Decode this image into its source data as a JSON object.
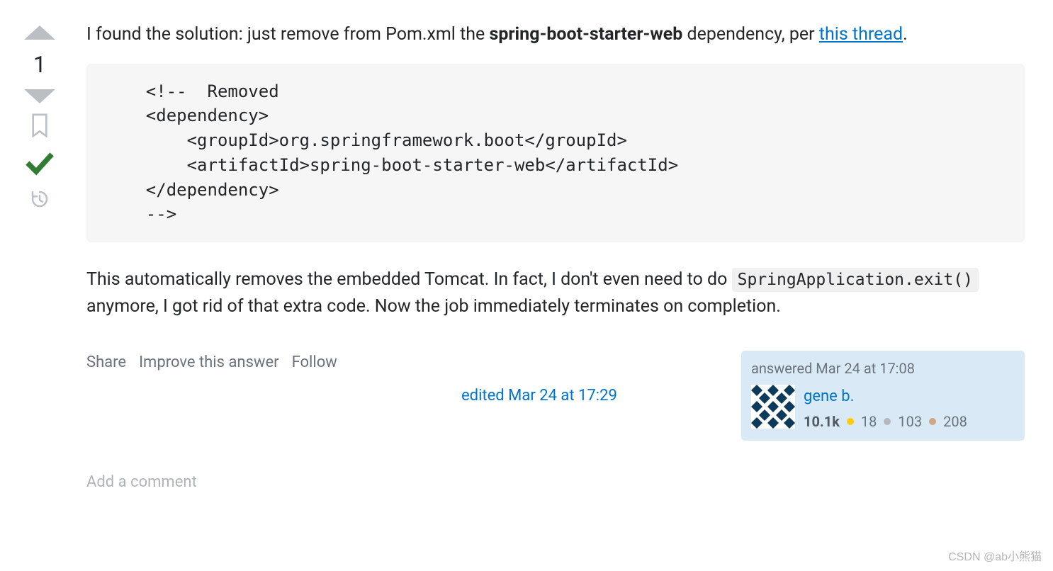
{
  "vote": {
    "score": "1"
  },
  "post": {
    "intro_pre": "I found the solution: just remove from Pom.xml the ",
    "intro_bold": "spring-boot-starter-web",
    "intro_mid": " dependency, per ",
    "intro_link": "this thread",
    "intro_end": ".",
    "code": "    <!--  Removed\n    <dependency>\n        <groupId>org.springframework.boot</groupId>\n        <artifactId>spring-boot-starter-web</artifactId>\n    </dependency>\n    -->",
    "para2_pre": "This automatically removes the embedded Tomcat. In fact, I don't even need to do ",
    "para2_code": "SpringApplication.exit()",
    "para2_post": " anymore, I got rid of that extra code. Now the job immediately terminates on completion."
  },
  "actions": {
    "share": "Share",
    "improve": "Improve this answer",
    "follow": "Follow"
  },
  "edited": {
    "label": "edited Mar 24 at 17:29"
  },
  "answered": {
    "label": "answered Mar 24 at 17:08"
  },
  "user": {
    "name": "gene b.",
    "rep": "10.1k",
    "gold": "18",
    "silver": "103",
    "bronze": "208"
  },
  "add_comment": "Add a comment",
  "watermark": "CSDN @ab小熊猫"
}
